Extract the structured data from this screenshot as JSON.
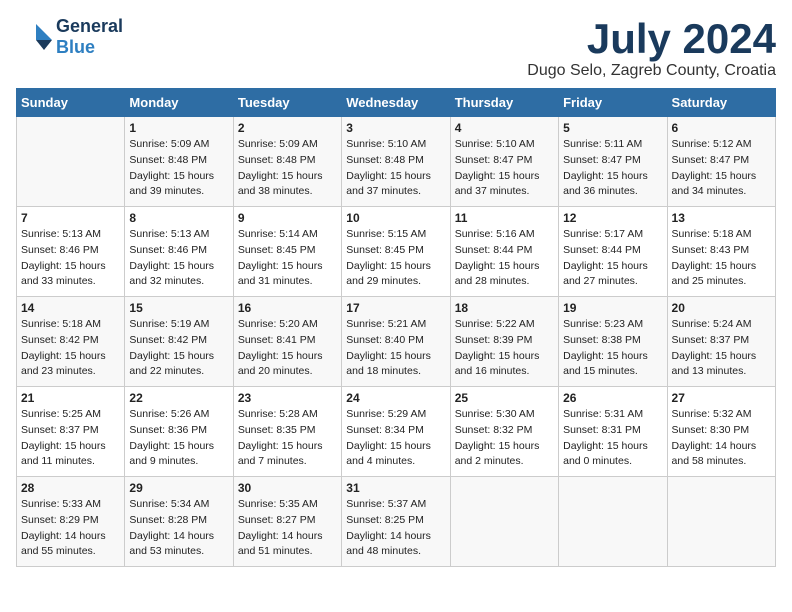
{
  "header": {
    "logo_general": "General",
    "logo_blue": "Blue",
    "month_year": "July 2024",
    "location": "Dugo Selo, Zagreb County, Croatia"
  },
  "weekdays": [
    "Sunday",
    "Monday",
    "Tuesday",
    "Wednesday",
    "Thursday",
    "Friday",
    "Saturday"
  ],
  "weeks": [
    [
      {
        "day": "",
        "detail": ""
      },
      {
        "day": "1",
        "detail": "Sunrise: 5:09 AM\nSunset: 8:48 PM\nDaylight: 15 hours\nand 39 minutes."
      },
      {
        "day": "2",
        "detail": "Sunrise: 5:09 AM\nSunset: 8:48 PM\nDaylight: 15 hours\nand 38 minutes."
      },
      {
        "day": "3",
        "detail": "Sunrise: 5:10 AM\nSunset: 8:48 PM\nDaylight: 15 hours\nand 37 minutes."
      },
      {
        "day": "4",
        "detail": "Sunrise: 5:10 AM\nSunset: 8:47 PM\nDaylight: 15 hours\nand 37 minutes."
      },
      {
        "day": "5",
        "detail": "Sunrise: 5:11 AM\nSunset: 8:47 PM\nDaylight: 15 hours\nand 36 minutes."
      },
      {
        "day": "6",
        "detail": "Sunrise: 5:12 AM\nSunset: 8:47 PM\nDaylight: 15 hours\nand 34 minutes."
      }
    ],
    [
      {
        "day": "7",
        "detail": "Sunrise: 5:13 AM\nSunset: 8:46 PM\nDaylight: 15 hours\nand 33 minutes."
      },
      {
        "day": "8",
        "detail": "Sunrise: 5:13 AM\nSunset: 8:46 PM\nDaylight: 15 hours\nand 32 minutes."
      },
      {
        "day": "9",
        "detail": "Sunrise: 5:14 AM\nSunset: 8:45 PM\nDaylight: 15 hours\nand 31 minutes."
      },
      {
        "day": "10",
        "detail": "Sunrise: 5:15 AM\nSunset: 8:45 PM\nDaylight: 15 hours\nand 29 minutes."
      },
      {
        "day": "11",
        "detail": "Sunrise: 5:16 AM\nSunset: 8:44 PM\nDaylight: 15 hours\nand 28 minutes."
      },
      {
        "day": "12",
        "detail": "Sunrise: 5:17 AM\nSunset: 8:44 PM\nDaylight: 15 hours\nand 27 minutes."
      },
      {
        "day": "13",
        "detail": "Sunrise: 5:18 AM\nSunset: 8:43 PM\nDaylight: 15 hours\nand 25 minutes."
      }
    ],
    [
      {
        "day": "14",
        "detail": "Sunrise: 5:18 AM\nSunset: 8:42 PM\nDaylight: 15 hours\nand 23 minutes."
      },
      {
        "day": "15",
        "detail": "Sunrise: 5:19 AM\nSunset: 8:42 PM\nDaylight: 15 hours\nand 22 minutes."
      },
      {
        "day": "16",
        "detail": "Sunrise: 5:20 AM\nSunset: 8:41 PM\nDaylight: 15 hours\nand 20 minutes."
      },
      {
        "day": "17",
        "detail": "Sunrise: 5:21 AM\nSunset: 8:40 PM\nDaylight: 15 hours\nand 18 minutes."
      },
      {
        "day": "18",
        "detail": "Sunrise: 5:22 AM\nSunset: 8:39 PM\nDaylight: 15 hours\nand 16 minutes."
      },
      {
        "day": "19",
        "detail": "Sunrise: 5:23 AM\nSunset: 8:38 PM\nDaylight: 15 hours\nand 15 minutes."
      },
      {
        "day": "20",
        "detail": "Sunrise: 5:24 AM\nSunset: 8:37 PM\nDaylight: 15 hours\nand 13 minutes."
      }
    ],
    [
      {
        "day": "21",
        "detail": "Sunrise: 5:25 AM\nSunset: 8:37 PM\nDaylight: 15 hours\nand 11 minutes."
      },
      {
        "day": "22",
        "detail": "Sunrise: 5:26 AM\nSunset: 8:36 PM\nDaylight: 15 hours\nand 9 minutes."
      },
      {
        "day": "23",
        "detail": "Sunrise: 5:28 AM\nSunset: 8:35 PM\nDaylight: 15 hours\nand 7 minutes."
      },
      {
        "day": "24",
        "detail": "Sunrise: 5:29 AM\nSunset: 8:34 PM\nDaylight: 15 hours\nand 4 minutes."
      },
      {
        "day": "25",
        "detail": "Sunrise: 5:30 AM\nSunset: 8:32 PM\nDaylight: 15 hours\nand 2 minutes."
      },
      {
        "day": "26",
        "detail": "Sunrise: 5:31 AM\nSunset: 8:31 PM\nDaylight: 15 hours\nand 0 minutes."
      },
      {
        "day": "27",
        "detail": "Sunrise: 5:32 AM\nSunset: 8:30 PM\nDaylight: 14 hours\nand 58 minutes."
      }
    ],
    [
      {
        "day": "28",
        "detail": "Sunrise: 5:33 AM\nSunset: 8:29 PM\nDaylight: 14 hours\nand 55 minutes."
      },
      {
        "day": "29",
        "detail": "Sunrise: 5:34 AM\nSunset: 8:28 PM\nDaylight: 14 hours\nand 53 minutes."
      },
      {
        "day": "30",
        "detail": "Sunrise: 5:35 AM\nSunset: 8:27 PM\nDaylight: 14 hours\nand 51 minutes."
      },
      {
        "day": "31",
        "detail": "Sunrise: 5:37 AM\nSunset: 8:25 PM\nDaylight: 14 hours\nand 48 minutes."
      },
      {
        "day": "",
        "detail": ""
      },
      {
        "day": "",
        "detail": ""
      },
      {
        "day": "",
        "detail": ""
      }
    ]
  ]
}
